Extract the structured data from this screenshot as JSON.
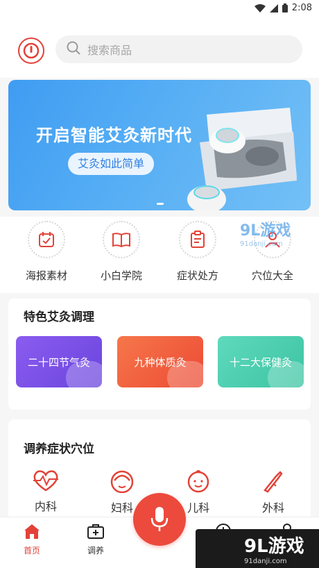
{
  "status_bar": {
    "time": "2:08"
  },
  "search": {
    "placeholder": "搜索商品"
  },
  "banner": {
    "title": "开启智能艾灸新时代",
    "subtitle": "艾灸如此简单"
  },
  "quick_nav": [
    {
      "label": "海报素材",
      "icon": "calendar-icon"
    },
    {
      "label": "小白学院",
      "icon": "book-icon"
    },
    {
      "label": "症状处方",
      "icon": "clipboard-icon"
    },
    {
      "label": "穴位大全",
      "icon": "acupoint-person-icon"
    }
  ],
  "featured": {
    "title": "特色艾灸调理",
    "items": [
      {
        "label": "二十四节气灸",
        "color": "#7b55e6"
      },
      {
        "label": "九种体质灸",
        "color": "#f0573d"
      },
      {
        "label": "十二大保健灸",
        "color": "#4fcfb0"
      }
    ]
  },
  "symptoms": {
    "title": "调养症状穴位",
    "items": [
      {
        "label": "内科",
        "icon": "heartbeat-icon"
      },
      {
        "label": "妇科",
        "icon": "woman-icon"
      },
      {
        "label": "儿科",
        "icon": "baby-icon"
      },
      {
        "label": "外科",
        "icon": "scalpel-icon"
      }
    ]
  },
  "bottom_nav": {
    "home": "首页",
    "tiaoyang": "调养"
  },
  "colors": {
    "accent": "#e24238",
    "banner": "#4aa6f3"
  },
  "watermark": {
    "badge": "9L游戏",
    "badge_url": "91danji.com",
    "corner": "9L游戏",
    "corner_url": "91danji.com"
  }
}
